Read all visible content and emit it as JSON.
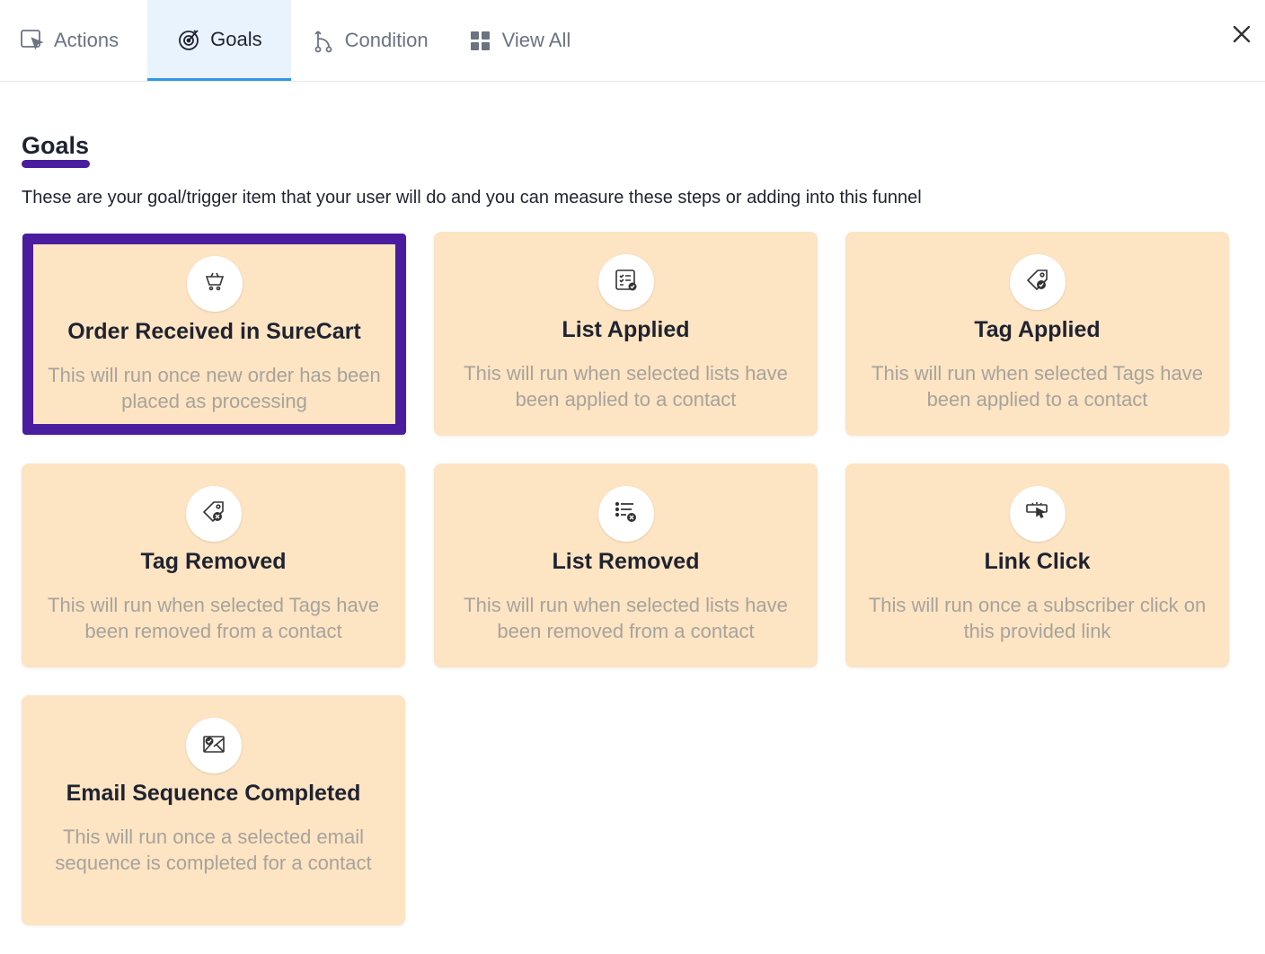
{
  "tabs": [
    {
      "label": "Actions",
      "icon": "cursor-icon"
    },
    {
      "label": "Goals",
      "icon": "target-icon"
    },
    {
      "label": "Condition",
      "icon": "branch-icon"
    },
    {
      "label": "View All",
      "icon": "grid-icon"
    }
  ],
  "active_tab": "Goals",
  "section": {
    "title": "Goals",
    "description": "These are your goal/trigger item that your user will do and you can measure these steps or adding into this funnel"
  },
  "cards": [
    {
      "title": "Order Received in SureCart",
      "description": "This will run once new order has been placed as processing",
      "icon": "cart-icon",
      "selected": true
    },
    {
      "title": "List Applied",
      "description": "This will run when selected lists have been applied to a contact",
      "icon": "list-check-icon",
      "selected": false
    },
    {
      "title": "Tag Applied",
      "description": "This will run when selected Tags have been applied to a contact",
      "icon": "tag-check-icon",
      "selected": false
    },
    {
      "title": "Tag Removed",
      "description": "This will run when selected Tags have been removed from a contact",
      "icon": "tag-remove-icon",
      "selected": false
    },
    {
      "title": "List Removed",
      "description": "This will run when selected lists have been removed from a contact",
      "icon": "list-remove-icon",
      "selected": false
    },
    {
      "title": "Link Click",
      "description": "This will run once a subscriber click on this provided link",
      "icon": "link-click-icon",
      "selected": false
    },
    {
      "title": "Email Sequence Completed",
      "description": "This will run once a selected email sequence is completed for a contact",
      "icon": "email-check-icon",
      "selected": false
    }
  ],
  "colors": {
    "accent": "#4a1d9e",
    "tab_active_bg": "#e8f3fd",
    "tab_active_border": "#2f97e8",
    "card_bg": "#fde4c3"
  }
}
